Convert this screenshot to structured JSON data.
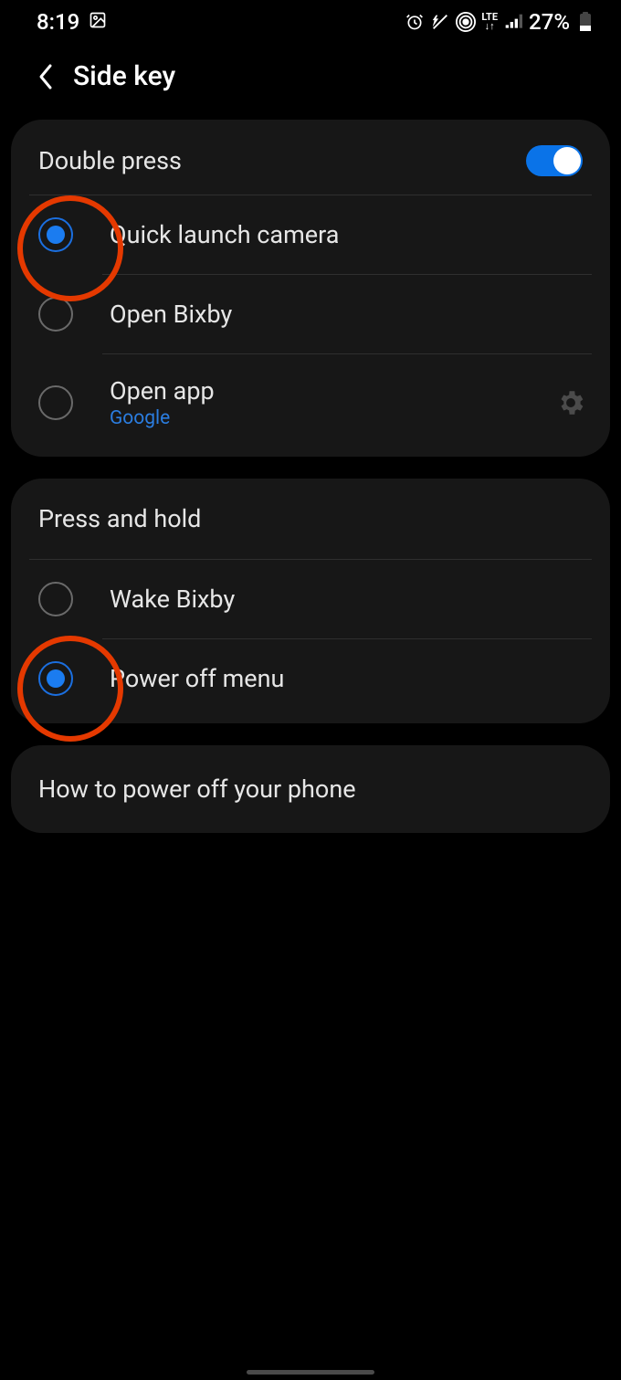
{
  "status": {
    "time": "8:19",
    "battery": "27%",
    "network_label": "LTE"
  },
  "header": {
    "title": "Side key"
  },
  "sections": {
    "double_press": {
      "title": "Double press",
      "toggle_on": true,
      "options": [
        {
          "label": "Quick launch camera",
          "selected": true
        },
        {
          "label": "Open Bixby",
          "selected": false
        },
        {
          "label": "Open app",
          "sub": "Google",
          "selected": false,
          "has_gear": true
        }
      ]
    },
    "press_hold": {
      "title": "Press and hold",
      "options": [
        {
          "label": "Wake Bixby",
          "selected": false
        },
        {
          "label": "Power off menu",
          "selected": true
        }
      ]
    }
  },
  "info": {
    "text": "How to power off your phone"
  }
}
